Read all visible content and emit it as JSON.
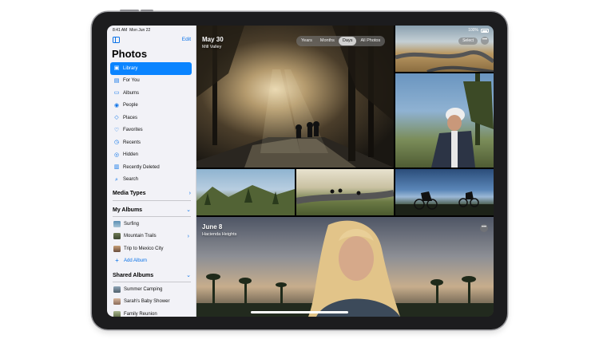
{
  "status": {
    "time": "8:41 AM",
    "date": "Mon Jun 22",
    "battery": "100%"
  },
  "sidebar": {
    "edit_label": "Edit",
    "title": "Photos",
    "library_items": [
      {
        "label": "Library",
        "icon": "photo-library-icon",
        "selected": true
      },
      {
        "label": "For You",
        "icon": "for-you-icon"
      },
      {
        "label": "Albums",
        "icon": "albums-icon"
      },
      {
        "label": "People",
        "icon": "people-icon"
      },
      {
        "label": "Places",
        "icon": "places-icon"
      },
      {
        "label": "Favorites",
        "icon": "heart-icon"
      },
      {
        "label": "Recents",
        "icon": "clock-icon"
      },
      {
        "label": "Hidden",
        "icon": "eye-icon"
      },
      {
        "label": "Recently Deleted",
        "icon": "trash-icon"
      },
      {
        "label": "Search",
        "icon": "search-icon"
      }
    ],
    "media_types_label": "Media Types",
    "my_albums_label": "My Albums",
    "my_albums": [
      {
        "label": "Surfing"
      },
      {
        "label": "Mountain Trails"
      },
      {
        "label": "Trip to Mexico City"
      }
    ],
    "add_album_label": "Add Album",
    "shared_albums_label": "Shared Albums",
    "shared_albums": [
      {
        "label": "Summer Camping"
      },
      {
        "label": "Sarah's Baby Shower"
      },
      {
        "label": "Family Reunion"
      }
    ]
  },
  "photos": {
    "segments": [
      "Years",
      "Months",
      "Days",
      "All Photos"
    ],
    "active_segment": "Days",
    "select_label": "Select",
    "more_label": "•••",
    "day1": {
      "title": "May 30",
      "subtitle": "Mill Valley"
    },
    "day2": {
      "title": "June 8",
      "subtitle": "Hacienda Heights"
    }
  },
  "colors": {
    "accent": "#0a84ff",
    "sidebar_bg": "#f2f2f7",
    "device": "#1c1c1e"
  }
}
